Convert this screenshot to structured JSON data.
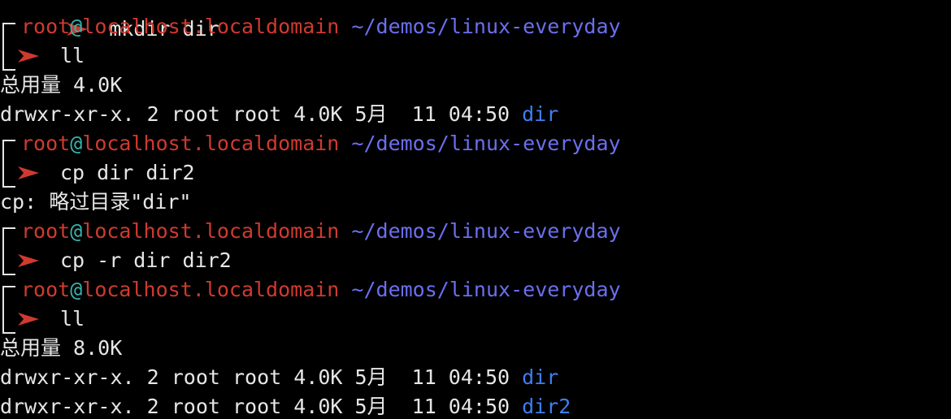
{
  "terminal": {
    "top_partial": {
      "command": "mkdir dir"
    },
    "blocks": [
      {
        "prompt": {
          "user": "root",
          "at": "@",
          "host": "localhost.localdomain",
          "path": "~/demos/linux-everyday"
        },
        "command": "ll",
        "output": [
          {
            "text": "总用量 4.0K"
          },
          {
            "perm": "drwxr-xr-x. 2 root root 4.0K 5月  11 04:50 ",
            "name": "dir"
          }
        ]
      },
      {
        "prompt": {
          "user": "root",
          "at": "@",
          "host": "localhost.localdomain",
          "path": "~/demos/linux-everyday"
        },
        "command": "cp dir dir2",
        "output": [
          {
            "text": "cp: 略过目录\"dir\""
          }
        ]
      },
      {
        "prompt": {
          "user": "root",
          "at": "@",
          "host": "localhost.localdomain",
          "path": "~/demos/linux-everyday"
        },
        "command": "cp -r dir dir2",
        "output": []
      },
      {
        "prompt": {
          "user": "root",
          "at": "@",
          "host": "localhost.localdomain",
          "path": "~/demos/linux-everyday"
        },
        "command": "ll",
        "output": [
          {
            "text": "总用量 8.0K"
          },
          {
            "perm": "drwxr-xr-x. 2 root root 4.0K 5月  11 04:50 ",
            "name": "dir"
          },
          {
            "perm": "drwxr-xr-x. 2 root root 4.0K 5月  11 04:50 ",
            "name": "dir2"
          }
        ]
      }
    ]
  },
  "colors": {
    "background": "#000000",
    "user_host": "#cf3a2f",
    "at_sign": "#38b2ac",
    "path": "#6b6fee",
    "directory": "#3e7ef0",
    "text": "#e6e6e6"
  },
  "icons": [
    "prompt-arrow-icon"
  ]
}
